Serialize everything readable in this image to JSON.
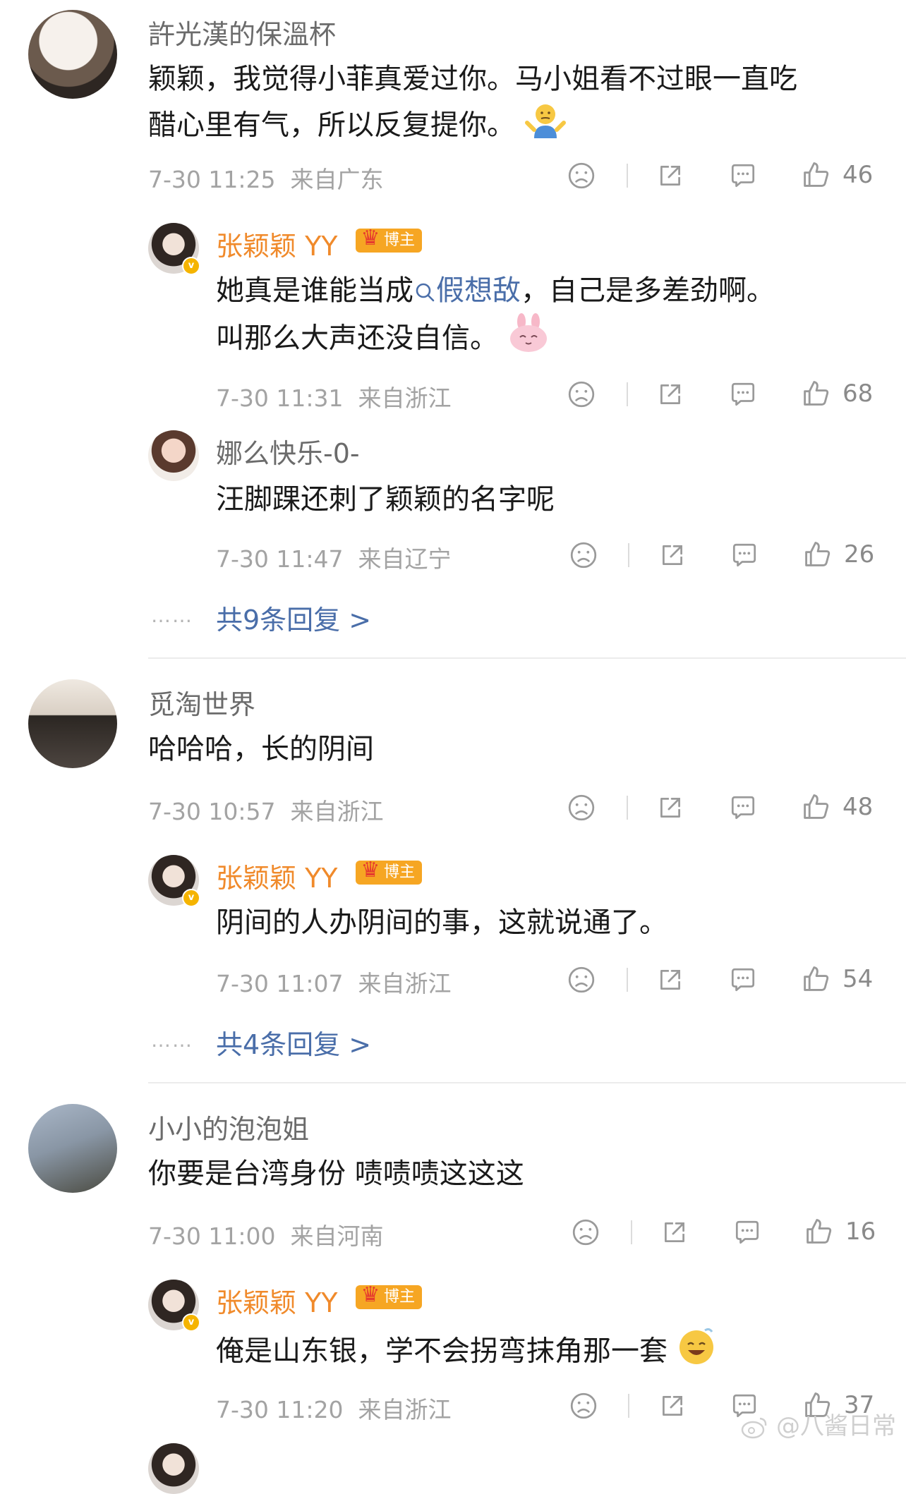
{
  "comments": [
    {
      "user": "許光漢的保溫杯",
      "text_line1": "颖颖，我觉得小菲真爱过你。马小姐看不过眼一直吃",
      "text_line2": "醋心里有气，所以反复提你。",
      "time": "7-30 11:25",
      "location": "来自广东",
      "likes": "46",
      "replies": [
        {
          "user": "张颖颖 YY",
          "badge": "博主",
          "text_line1_a": "她真是谁能当成",
          "text_line1_link": "假想敌",
          "text_line1_b": "，自己是多差劲啊。",
          "text_line2": "叫那么大声还没自信。",
          "time": "7-30 11:31",
          "location": "来自浙江",
          "likes": "68"
        },
        {
          "user": "娜么快乐-0-",
          "text": "汪脚踝还刺了颖颖的名字呢",
          "time": "7-30 11:47",
          "location": "来自辽宁",
          "likes": "26"
        }
      ],
      "more_dots": "……",
      "more_replies": "共9条回复 >"
    },
    {
      "user": "觅淘世界",
      "text": "哈哈哈，长的阴间",
      "time": "7-30 10:57",
      "location": "来自浙江",
      "likes": "48",
      "replies": [
        {
          "user": "张颖颖 YY",
          "badge": "博主",
          "text": "阴间的人办阴间的事，这就说通了。",
          "time": "7-30 11:07",
          "location": "来自浙江",
          "likes": "54"
        }
      ],
      "more_dots": "……",
      "more_replies": "共4条回复 >"
    },
    {
      "user": "小小的泡泡姐",
      "text": "你要是台湾身份 啧啧啧这这这",
      "time": "7-30 11:00",
      "location": "来自河南",
      "likes": "16",
      "replies": [
        {
          "user": "张颖颖 YY",
          "badge": "博主",
          "text": "俺是山东银，学不会拐弯抹角那一套",
          "time": "7-30 11:20",
          "location": "来自浙江",
          "likes": "37"
        }
      ]
    }
  ],
  "watermark": "@八酱日常",
  "colors": {
    "link": "#4a6ea9",
    "blogger_name": "#f08a2b",
    "badge": "#f6a623",
    "meta": "#a3a3a3"
  }
}
